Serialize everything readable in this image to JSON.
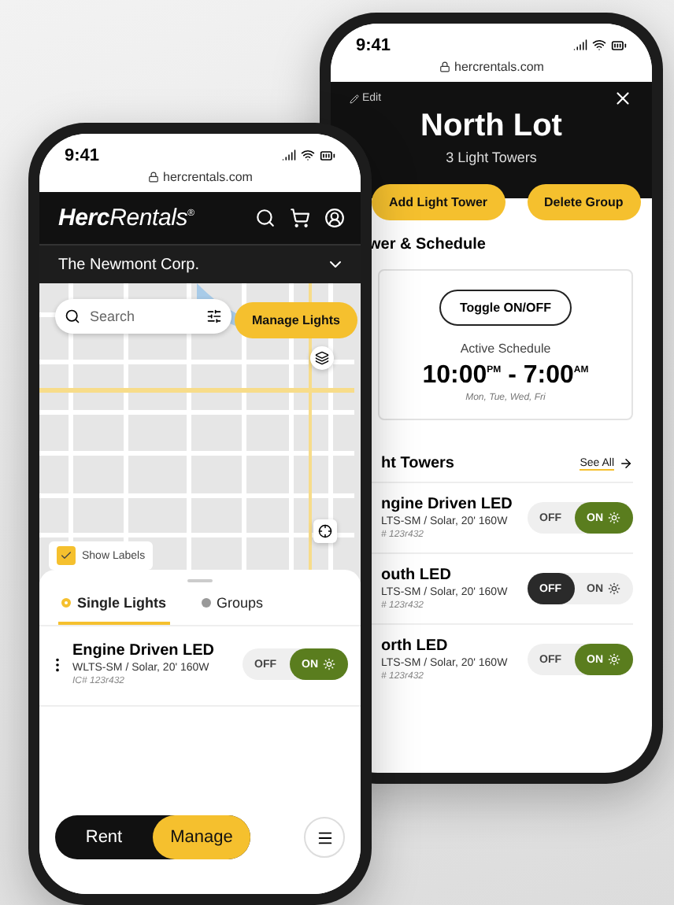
{
  "right_phone": {
    "status_time": "9:41",
    "url": "hercrentals.com",
    "edit": "Edit",
    "title": "North Lot",
    "subtitle": "3 Light Towers",
    "actions": [
      "Add Light Tower",
      "Delete Group"
    ],
    "schedule_heading": "wer & Schedule",
    "toggle_button": "Toggle ON/OFF",
    "schedule_label": "Active Schedule",
    "schedule_time": "10:00$^{PM}$ - 7:00$^{AM}$",
    "schedule_days": "Mon, Tue, Wed, Fri",
    "towers_heading": "ht Towers",
    "see_all": "See All",
    "lights": [
      {
        "name": "ngine Driven LED",
        "spec": "LTS-SM / Solar, 20' 160W",
        "ic": "# 123r432",
        "off_label": "OFF",
        "on_label": "ON",
        "on": true
      },
      {
        "name": "outh LED",
        "spec": "LTS-SM / Solar, 20' 160W",
        "ic": "# 123r432",
        "off_label": "OFF",
        "on_label": "ON",
        "on": false
      },
      {
        "name": "orth LED",
        "spec": "LTS-SM / Solar, 20' 160W",
        "ic": "# 123r432",
        "off_label": "OFF",
        "on_label": "ON",
        "on": true
      }
    ]
  },
  "left_phone": {
    "status_time": "9:41",
    "url": "hercrentals.com",
    "brand": "**Herc**Rentals$^{®}$",
    "company": "The Newmont Corp.",
    "search": {
      "placeholder": "Search"
    },
    "manage_button": "Manage Lights",
    "show_labels": {
      "label": "Show Labels",
      "checked": true
    },
    "tabs": [
      {
        "label": "Single Lights",
        "selected": true
      },
      {
        "label": "Groups",
        "selected": false
      }
    ],
    "lights": [
      {
        "name": "Engine Driven LED",
        "spec": "WLTS-SM / Solar, 20' 160W",
        "ic": "IC# 123r432",
        "off_label": "OFF",
        "on_label": "ON",
        "on": true
      }
    ],
    "modes": [
      {
        "label": "Rent",
        "selected": false
      },
      {
        "label": "Manage",
        "selected": true
      }
    ]
  }
}
